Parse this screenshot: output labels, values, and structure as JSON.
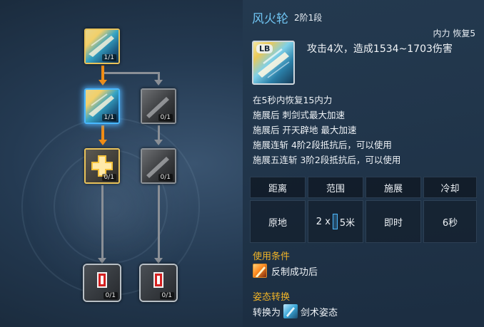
{
  "tree": {
    "nodes": [
      {
        "id": "root",
        "count": "1/1",
        "style": "gold",
        "icon": "fire-wheel-sword-icon"
      },
      {
        "id": "tier2-left",
        "count": "1/1",
        "style": "blue-selected",
        "icon": "fire-wheel-sword-icon"
      },
      {
        "id": "tier2-right",
        "count": "0/1",
        "style": "gray-locked",
        "icon": "sword-slash-icon"
      },
      {
        "id": "tier3-left",
        "count": "0/1",
        "style": "gold",
        "icon": "plus-icon"
      },
      {
        "id": "tier3-right",
        "count": "0/1",
        "style": "gray-locked",
        "icon": "sword-slash-icon"
      },
      {
        "id": "tier4-left",
        "count": "0/1",
        "style": "ornate",
        "icon": "red-scroll-icon"
      },
      {
        "id": "tier4-right",
        "count": "0/1",
        "style": "ornate",
        "icon": "red-scroll-icon"
      }
    ],
    "colors": {
      "active_path": "#f08c14",
      "inactive_path": "#8a8f96",
      "selected_glow": "#49b8ff"
    }
  },
  "detail": {
    "name": "风火轮",
    "rank": "2阶1段",
    "recover": "内力 恢复5",
    "key_badge": "LB",
    "damage": "攻击4次，造成1534~1703伤害",
    "effects": [
      "在5秒内恢复15内力",
      "施展后 刺剑式最大加速",
      "施展后 开天辟地 最大加速",
      "施展连斩 4阶2段抵抗后，可以使用",
      "施展五连斩 3阶2段抵抗后，可以使用"
    ],
    "stats": {
      "headers": [
        "距离",
        "范围",
        "施展",
        "冷却"
      ],
      "values": {
        "distance": "原地",
        "range_prefix": "2 x",
        "range_suffix": "5米",
        "cast": "即时",
        "cooldown": "6秒"
      }
    },
    "condition_label": "使用条件",
    "condition_text": "反制成功后",
    "stance_label": "姿态转换",
    "stance_prefix": "转换为",
    "stance_text": "剑术姿态",
    "colors": {
      "title": "#6fc3f0",
      "section": "#f0b428"
    }
  }
}
